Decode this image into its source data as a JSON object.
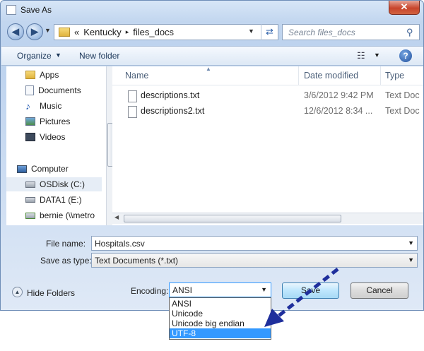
{
  "window": {
    "title": "Save As",
    "close_label": "✕"
  },
  "address_bar": {
    "prefix": "«",
    "segments": [
      "Kentucky",
      "files_docs"
    ],
    "separator": "▸",
    "search_placeholder": "Search files_docs"
  },
  "toolbar": {
    "organize_label": "Organize",
    "new_folder_label": "New folder",
    "help_label": "?"
  },
  "nav": {
    "items": [
      {
        "label": "Apps",
        "icon": "folder-icon"
      },
      {
        "label": "Documents",
        "icon": "documents-icon"
      },
      {
        "label": "Music",
        "icon": "music-icon"
      },
      {
        "label": "Pictures",
        "icon": "pictures-icon"
      },
      {
        "label": "Videos",
        "icon": "videos-icon"
      },
      {
        "label": "Computer",
        "icon": "computer-icon"
      },
      {
        "label": "OSDisk (C:)",
        "icon": "drive-icon",
        "selected": true
      },
      {
        "label": "DATA1 (E:)",
        "icon": "drive-icon"
      },
      {
        "label": "bernie (\\\\metro",
        "icon": "network-drive-icon"
      }
    ]
  },
  "file_list": {
    "columns": [
      "Name",
      "Date modified",
      "Type"
    ],
    "rows": [
      {
        "name": "descriptions.txt",
        "date": "3/6/2012 9:42 PM",
        "type": "Text Doc"
      },
      {
        "name": "descriptions2.txt",
        "date": "12/6/2012 8:34 ...",
        "type": "Text Doc"
      }
    ]
  },
  "form": {
    "file_name_label": "File name:",
    "file_name_value": "Hospitals.csv",
    "save_as_type_label": "Save as type:",
    "save_as_type_value": "Text Documents (*.txt)",
    "encoding_label": "Encoding:",
    "encoding_value": "ANSI",
    "encoding_options": [
      "ANSI",
      "Unicode",
      "Unicode big endian",
      "UTF-8"
    ],
    "encoding_highlighted": "UTF-8",
    "hide_folders_label": "Hide Folders",
    "save_label": "Save",
    "cancel_label": "Cancel"
  },
  "colors": {
    "accent": "#3399ff",
    "annotation_arrow": "#1f2f9c"
  }
}
